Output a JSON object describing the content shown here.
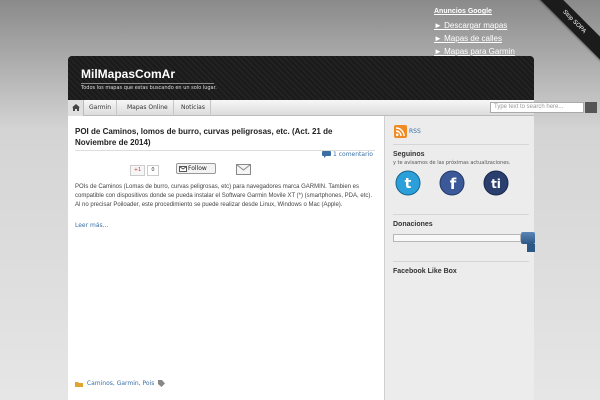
{
  "ads": {
    "title": "Anuncios Google",
    "links": [
      "► Descargar mapas",
      "► Mapas de calles",
      "► Mapas para Garmin"
    ]
  },
  "ribbon": "Stop SOPA",
  "header": {
    "title": "MilMapasComAr",
    "tagline": "Todos los mapas que estas buscando en un solo lugar."
  },
  "nav": {
    "items": [
      "Garmin",
      "Mapas Online",
      "Noticias"
    ],
    "search_placeholder": "Type text to search here..."
  },
  "post": {
    "title": "POI de Caminos, lomos de burro, curvas peligrosas, etc. (Act. 21 de Noviembre de 2014)",
    "comments": "1 comentario",
    "gplus_label": "+1",
    "gplus_count": "0",
    "follow_label": "Follow",
    "body": "POIs de Caminos (Lomas de burro, curvas peligrosas, etc) para navegadores marca GARMIN. Tambien es compatible con dispositivos donde se pueda instalar el Software Garmin Movile XT (*) (smartphones, PDA, etc). Al no precisar Poiloader, este procedimiento se puede realizar desde Linux, Windows o Mac (Apple).",
    "read_more": "Leer más...",
    "tags": "Caminos, Garmin, Pois"
  },
  "sidebar": {
    "rss_label": "RSS",
    "follow_title": "Seguinos",
    "follow_sub": "y te avisamos de las próximas actualizaciones.",
    "donate_title": "Donaciones",
    "facebook_title": "Facebook Like Box"
  },
  "colors": {
    "link": "#3a6ea5",
    "header_bg": "#1a1a1a",
    "twitter": "#2b9fd9",
    "facebook": "#3b5998",
    "tuenti": "#2a3f6e"
  },
  "icons": [
    "home-icon",
    "comment-icon",
    "mail-icon",
    "rss-icon",
    "twitter-icon",
    "facebook-icon",
    "tuenti-icon",
    "folder-icon",
    "tag-icon"
  ]
}
